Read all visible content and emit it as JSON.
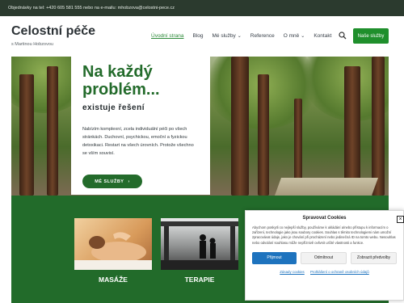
{
  "topbar": {
    "text": "Objednávky na tel: +420 605 581 555 nebo na e-mailu: mhobzova@celostni-pece.cz"
  },
  "header": {
    "title": "Celostní péče",
    "subtitle": "s Martinou Hobzovou",
    "nav": [
      {
        "label": "Úvodní strana",
        "active": true
      },
      {
        "label": "Blog"
      },
      {
        "label": "Mé služby",
        "dropdown": true
      },
      {
        "label": "Reference"
      },
      {
        "label": "O mně",
        "dropdown": true
      },
      {
        "label": "Kontakt"
      }
    ],
    "cta": "Naše služby"
  },
  "hero": {
    "headline": "Na každý problém...",
    "subheadline": "existuje řešení",
    "body": "Nabízím komplexní, zcela individuální péči po všech stránkách. Duchovní, psychickou, emoční a fyzickou detoxikaci. Restart na všech úrovních. Protože všechno se vším souvisí.",
    "button": "MÉ SLUŽBY"
  },
  "services": [
    {
      "label": "MASÁŽE"
    },
    {
      "label": "TERAPIE"
    }
  ],
  "cookie": {
    "title": "Spravovat Cookies",
    "text": "Abychom poskytli co nejlepší služby, používáme k ukládání a/nebo přístupu k informacím o zařízení, technologie jako jsou soubory cookies. Souhlas s těmito technologiemi nám umožní zpracovávat údaje, jako je chování při procházení nebo jedinečná ID na tomto webu. Nesouhlas nebo odvolání souhlasu může nepříznivě ovlivnit určité vlastnosti a funkce.",
    "accept": "Přijmout",
    "deny": "Odmítnout",
    "prefs": "Zobrazit předvolby",
    "link1": "Zásady cookies",
    "link2": "Prohlášení o ochraně osobních údajů"
  },
  "colors": {
    "brand_green": "#226b2a",
    "cta_green": "#1f8f2c",
    "cookie_blue": "#1e73be"
  }
}
